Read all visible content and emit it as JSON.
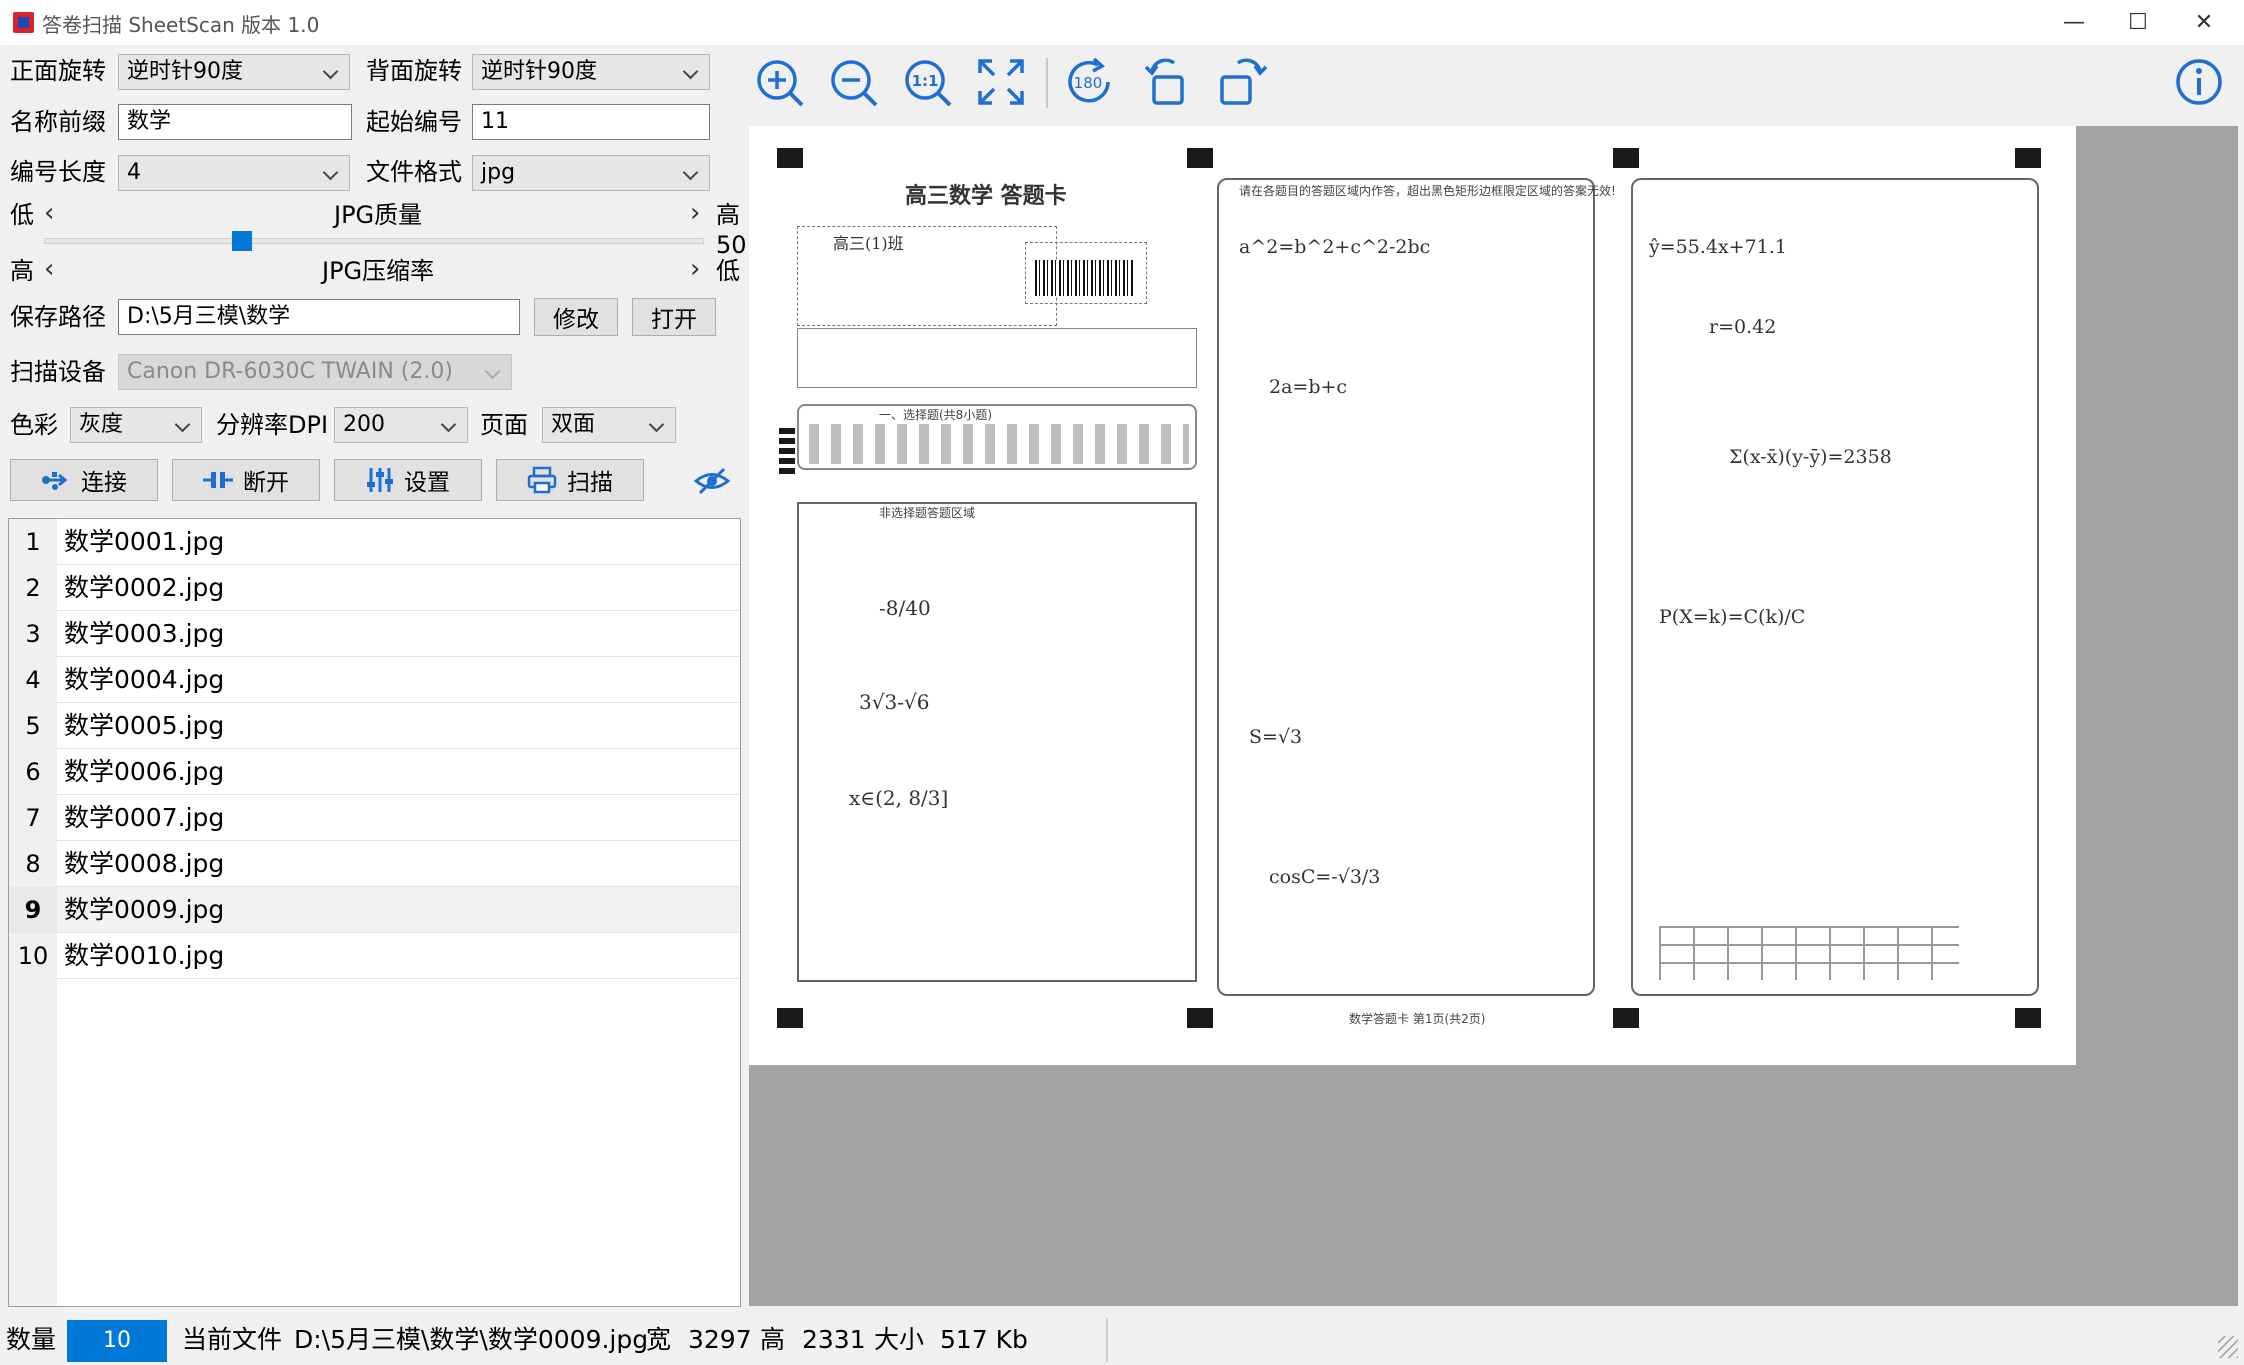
{
  "window": {
    "title": "答卷扫描 SheetScan 版本 1.0",
    "controls": [
      "—",
      "☐",
      "✕"
    ]
  },
  "settings": {
    "front_rotation": {
      "label": "正面旋转",
      "value": "逆时针90度"
    },
    "back_rotation": {
      "label": "背面旋转",
      "value": "逆时针90度"
    },
    "name_prefix": {
      "label": "名称前缀",
      "value": "数学"
    },
    "start_number": {
      "label": "起始编号",
      "value": "11"
    },
    "number_length": {
      "label": "编号长度",
      "value": "4"
    },
    "file_format": {
      "label": "文件格式",
      "value": "jpg"
    },
    "jpg_quality": {
      "label": "JPG质量",
      "low": "低",
      "high": "高",
      "value": "50",
      "level": 0.5
    },
    "jpg_compression": {
      "label": "JPG压缩率",
      "left": "高",
      "right": "低"
    },
    "save_path": {
      "label": "保存路径",
      "value": "D:\\5月三模\\数学",
      "modify": "修改",
      "open": "打开"
    },
    "scan_device": {
      "label": "扫描设备",
      "value": "Canon DR-6030C TWAIN (2.0)"
    },
    "color": {
      "label": "色彩",
      "value": "灰度"
    },
    "dpi": {
      "label": "分辨率DPI",
      "value": "200"
    },
    "page": {
      "label": "页面",
      "value": "双面"
    }
  },
  "actions": {
    "connect": "连接",
    "disconnect": "断开",
    "settings": "设置",
    "scan": "扫描",
    "preview_icon": "eye-icon"
  },
  "files": [
    {
      "n": "1",
      "name": "数学0001.jpg"
    },
    {
      "n": "2",
      "name": "数学0002.jpg"
    },
    {
      "n": "3",
      "name": "数学0003.jpg"
    },
    {
      "n": "4",
      "name": "数学0004.jpg"
    },
    {
      "n": "5",
      "name": "数学0005.jpg"
    },
    {
      "n": "6",
      "name": "数学0006.jpg"
    },
    {
      "n": "7",
      "name": "数学0007.jpg"
    },
    {
      "n": "8",
      "name": "数学0008.jpg"
    },
    {
      "n": "9",
      "name": "数学0009.jpg",
      "selected": true
    },
    {
      "n": "10",
      "name": "数学0010.jpg"
    }
  ],
  "toolbar": {
    "icons": [
      "zoom-in-icon",
      "zoom-out-icon",
      "actual-size-icon",
      "fit-window-icon",
      "rotate-180-icon",
      "rotate-left-icon",
      "rotate-right-icon"
    ],
    "actual_size_text": "1:1",
    "rotate_180_text": "180",
    "info_icon": "info-icon"
  },
  "scan": {
    "title": "高三数学  答题卡",
    "notice": "请在各题目的答题区域内作答，超出黑色矩形边框限定区域的答案无效!",
    "section_fill": "一、选择题(共8小题)",
    "section_blank": "非选择题答题区域",
    "footer": "数学答题卡 第1页(共2页)",
    "handwriting": {
      "col1": [
        "-8/40",
        "3√3-√6",
        "x∈(2, 8/3]"
      ],
      "col2": [
        "a^2=b^2+c^2-2bc",
        "2a=b+c",
        "S=√3",
        "cosC=-√3/3"
      ],
      "col3": [
        "ŷ=55.4x+71.1",
        "r=0.42",
        "Σ(x-x̄)(y-ȳ)=2358",
        "P(X=k)=C(k)/C"
      ]
    }
  },
  "status": {
    "count_label": "数量",
    "count_value": "10",
    "file_label": "当前文件",
    "file_value": "D:\\5月三模\\数学\\数学0009.jpg",
    "width_label": "宽",
    "width_value": "3297",
    "height_label": "高",
    "height_value": "2331",
    "size_label": "大小",
    "size_value": "517 Kb"
  }
}
